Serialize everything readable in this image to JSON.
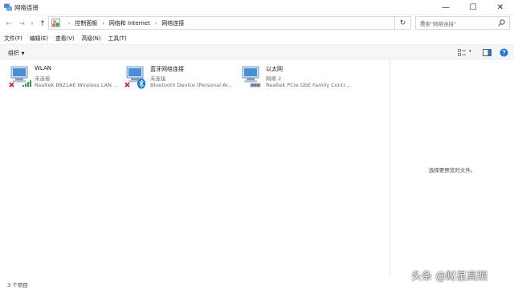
{
  "window": {
    "title": "网络连接",
    "minimize_glyph": "—",
    "maximize_glyph": "☐",
    "close_glyph": "✕"
  },
  "nav": {
    "back_glyph": "←",
    "forward_glyph": "→",
    "recent_glyph": "∨",
    "up_glyph": "↑",
    "refresh_glyph": "↻",
    "address_dropdown_glyph": "∨",
    "crumb_separator": "›",
    "breadcrumbs": [
      "控制面板",
      "网络和 Internet",
      "网络连接"
    ]
  },
  "search": {
    "placeholder": "搜索\"网络连接\""
  },
  "menu": [
    "文件(F)",
    "编辑(E)",
    "查看(V)",
    "高级(N)",
    "工具(T)"
  ],
  "toolbar": {
    "organize_label": "组织",
    "organize_caret": "▼",
    "view_caret": "▾"
  },
  "connections": [
    {
      "name": "WLAN",
      "status": "未连接",
      "device": "Realtek 8821AE Wireless LAN ...",
      "badge_icon": "wifi-signal-icon",
      "disconnected": true
    },
    {
      "name": "蓝牙网络连接",
      "status": "未连接",
      "device": "Bluetooth Device (Personal Ar...",
      "badge_icon": "bluetooth-icon",
      "disconnected": true
    },
    {
      "name": "以太网",
      "status": "网络 2",
      "device": "Realtek PCIe GbE Family Contr...",
      "badge_icon": "ethernet-cable-icon",
      "disconnected": false
    }
  ],
  "preview": {
    "message": "选择要预览的文件。"
  },
  "status": {
    "item_count": "3 个项目"
  },
  "watermark": "头条 @财星高照",
  "colors": {
    "disconnected_x": "#d8252c",
    "bluetooth": "#1273d1",
    "wifi_bars": "#2f9e45",
    "monitor": "#4a8fd6"
  }
}
